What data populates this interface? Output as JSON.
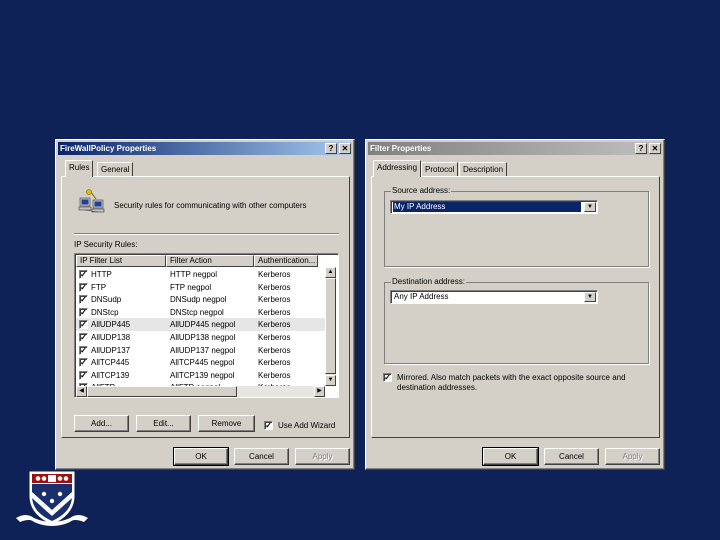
{
  "firewall_dialog": {
    "title": "FireWallPolicy Properties",
    "help_btn": "?",
    "close_btn": "✕",
    "tabs": [
      "Rules",
      "General"
    ],
    "description": "Security rules for communicating with other computers",
    "rules_label": "IP Security Rules:",
    "columns": [
      "IP Filter List",
      "Filter Action",
      "Authentication..."
    ],
    "rows": [
      {
        "checked": true,
        "filter": "HTTP",
        "action": "HTTP negpol",
        "auth": "Kerberos"
      },
      {
        "checked": true,
        "filter": "FTP",
        "action": "FTP negpol",
        "auth": "Kerberos"
      },
      {
        "checked": true,
        "filter": "DNSudp",
        "action": "DNSudp negpol",
        "auth": "Kerberos"
      },
      {
        "checked": true,
        "filter": "DNStcp",
        "action": "DNStcp negpol",
        "auth": "Kerberos"
      },
      {
        "checked": true,
        "filter": "AllUDP445",
        "action": "AllUDP445 negpol",
        "auth": "Kerberos"
      },
      {
        "checked": true,
        "filter": "AllUDP138",
        "action": "AllUDP138 negpol",
        "auth": "Kerberos"
      },
      {
        "checked": true,
        "filter": "AllUDP137",
        "action": "AllUDP137 negpol",
        "auth": "Kerberos"
      },
      {
        "checked": true,
        "filter": "AllTCP445",
        "action": "AllTCP445 negpol",
        "auth": "Kerberos"
      },
      {
        "checked": true,
        "filter": "AllTCP139",
        "action": "AllTCP139 negpol",
        "auth": "Kerberos"
      },
      {
        "checked": true,
        "filter": "AllFTP",
        "action": "AllFTP negpol",
        "auth": "Kerberos"
      }
    ],
    "buttons": {
      "add": "Add...",
      "edit": "Edit...",
      "remove": "Remove"
    },
    "use_wizard": {
      "label": "Use Add Wizard",
      "checked": true
    },
    "footer": {
      "ok": "OK",
      "cancel": "Cancel",
      "apply": "Apply"
    }
  },
  "filter_dialog": {
    "title": "Filter Properties",
    "help_btn": "?",
    "close_btn": "✕",
    "tabs": [
      "Addressing",
      "Protocol",
      "Description"
    ],
    "source": {
      "label": "Source address:",
      "value": "My IP Address"
    },
    "destination": {
      "label": "Destination address:",
      "value": "Any IP Address"
    },
    "mirrored": {
      "checked": true,
      "label_line1": "Mirrored. Also match packets with the exact opposite source and",
      "label_line2": "destination addresses."
    },
    "footer": {
      "ok": "OK",
      "cancel": "Cancel",
      "apply": "Apply"
    }
  },
  "colors": {
    "background": "#0f2257",
    "title_active": "#0a246a",
    "dialog": "#d4d0c8"
  },
  "icons": [
    "network-computers-icon",
    "university-shield-logo"
  ]
}
